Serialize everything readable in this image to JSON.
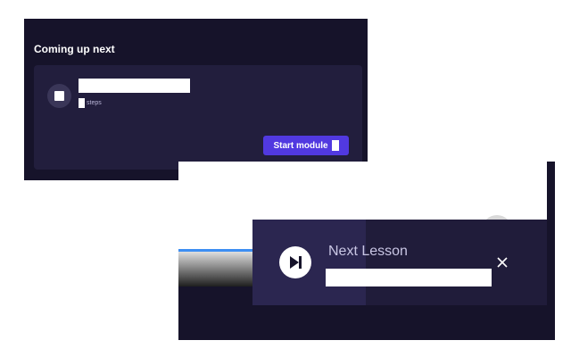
{
  "upnext": {
    "title": "Coming up next",
    "module": {
      "icon": "stop-square-icon",
      "steps_label": "steps"
    },
    "start_button": {
      "label": "Start module",
      "icon": "module-icon"
    }
  },
  "player": {
    "progress_color": "#3d8ef2",
    "next_lesson": {
      "heading": "Next Lesson",
      "play_icon": "skip-next-icon",
      "close_icon": "close-icon"
    }
  },
  "colors": {
    "background_dark": "#16132a",
    "card": "#221e3d",
    "accent": "#5139e0"
  }
}
